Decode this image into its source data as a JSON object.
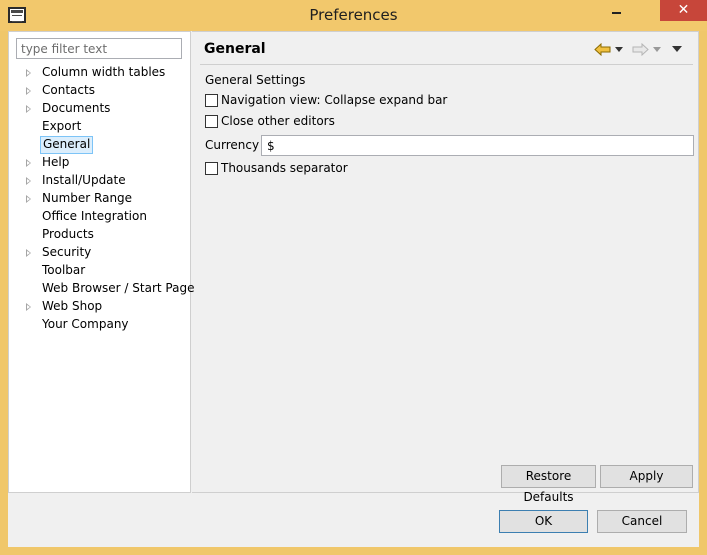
{
  "window": {
    "title": "Preferences",
    "close_glyph": "✕"
  },
  "filter": {
    "placeholder": "type filter text",
    "value": ""
  },
  "tree": [
    {
      "label": "Column width tables",
      "expandable": true
    },
    {
      "label": "Contacts",
      "expandable": true
    },
    {
      "label": "Documents",
      "expandable": true
    },
    {
      "label": "Export",
      "expandable": false
    },
    {
      "label": "General",
      "expandable": false,
      "selected": true
    },
    {
      "label": "Help",
      "expandable": true
    },
    {
      "label": "Install/Update",
      "expandable": true
    },
    {
      "label": "Number Range",
      "expandable": true
    },
    {
      "label": "Office Integration",
      "expandable": false
    },
    {
      "label": "Products",
      "expandable": false
    },
    {
      "label": "Security",
      "expandable": true
    },
    {
      "label": "Toolbar",
      "expandable": false
    },
    {
      "label": "Web Browser / Start Page",
      "expandable": false
    },
    {
      "label": "Web Shop",
      "expandable": true
    },
    {
      "label": "Your Company",
      "expandable": false
    }
  ],
  "page": {
    "title": "General",
    "group_title": "General Settings",
    "options": [
      {
        "label": "Navigation view: Collapse expand bar",
        "checked": false
      },
      {
        "label": "Close other editors",
        "checked": false
      }
    ],
    "currency_label": "Currency",
    "currency_value": "$",
    "thousands_label": "Thousands separator",
    "thousands_checked": false
  },
  "buttons": {
    "restore_defaults": "Restore Defaults",
    "apply": "Apply",
    "ok": "OK",
    "cancel": "Cancel"
  },
  "icons": {
    "back": "arrow-left-icon",
    "forward": "arrow-right-icon",
    "menu": "view-menu-icon"
  },
  "colors": {
    "titlebar": "#f2c86c",
    "close_button": "#c7463a",
    "selection_fill": "#dceefc",
    "selection_border": "#7dc4f7",
    "back_arrow": "#f0c040"
  }
}
